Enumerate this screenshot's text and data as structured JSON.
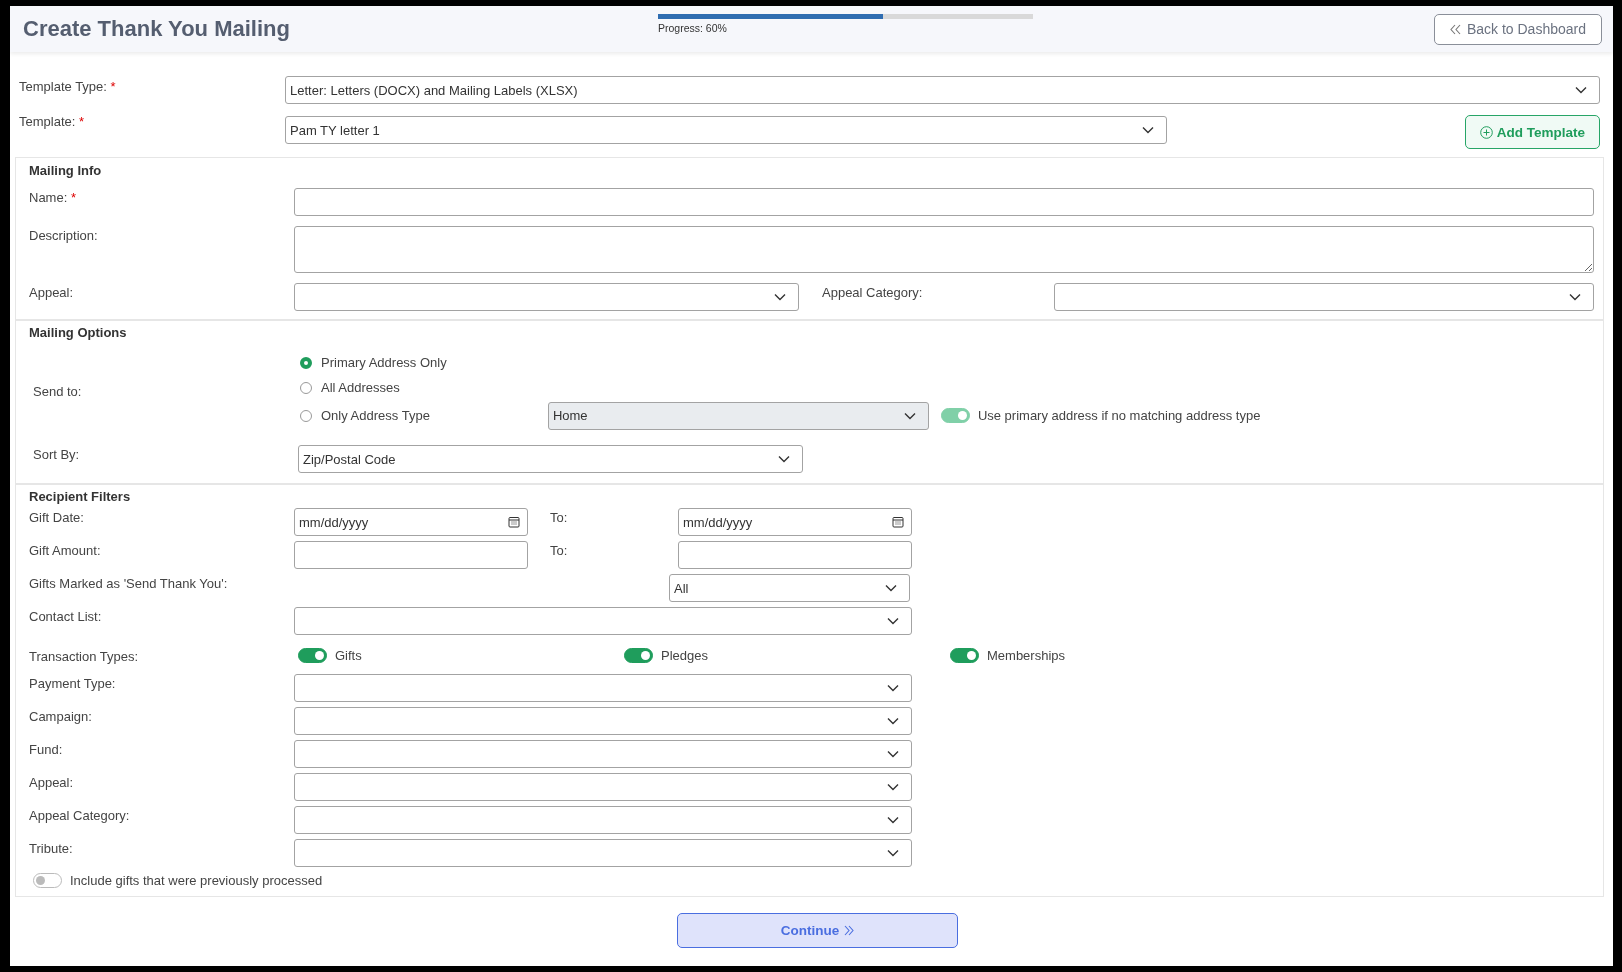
{
  "header": {
    "title": "Create Thank You Mailing",
    "progress": {
      "label": "Progress: 60%",
      "level": 0.6
    },
    "back_button": "Back to Dashboard"
  },
  "template_type": {
    "label": "Template Type:",
    "required_mark": "*",
    "value": "Letter: Letters (DOCX) and Mailing Labels (XLSX)"
  },
  "template": {
    "label": "Template:",
    "required_mark": "*",
    "value": "Pam TY letter 1"
  },
  "add_template_button": "Add Template",
  "mailing_info": {
    "title": "Mailing Info",
    "name": {
      "label": "Name:",
      "required_mark": "*"
    },
    "description": {
      "label": "Description:"
    },
    "appeal": {
      "label": "Appeal:"
    },
    "appeal_category": {
      "label": "Appeal Category:"
    }
  },
  "mailing_options": {
    "title": "Mailing Options",
    "send_to": {
      "label": "Send to:",
      "options": [
        {
          "label": "Primary Address Only",
          "selected": true
        },
        {
          "label": "All Addresses",
          "selected": false
        },
        {
          "label": "Only Address Type",
          "selected": false
        }
      ],
      "address_type": {
        "value": "Home",
        "disabled": true
      },
      "use_primary": {
        "label": "Use primary address if no matching address type",
        "on": true,
        "disabled": true
      }
    },
    "sort_by": {
      "label": "Sort By:",
      "value": "Zip/Postal Code"
    }
  },
  "recipient_filters": {
    "title": "Recipient Filters",
    "gift_date": {
      "label": "Gift Date:",
      "placeholder": "mm/dd/yyyy",
      "to_label": "To:",
      "to_placeholder": "mm/dd/yyyy"
    },
    "gift_amount": {
      "label": "Gift Amount:",
      "to_label": "To:"
    },
    "send_thank_you": {
      "label": "Gifts Marked as 'Send Thank You':",
      "value": "All"
    },
    "contact_list": {
      "label": "Contact List:"
    },
    "transaction_types": {
      "label": "Transaction Types:",
      "items": [
        {
          "label": "Gifts",
          "on": true
        },
        {
          "label": "Pledges",
          "on": true
        },
        {
          "label": "Memberships",
          "on": true
        }
      ]
    },
    "dropdowns": [
      {
        "label": "Payment Type:"
      },
      {
        "label": "Campaign:"
      },
      {
        "label": "Fund:"
      },
      {
        "label": "Appeal:"
      },
      {
        "label": "Appeal Category:"
      },
      {
        "label": "Tribute:"
      }
    ],
    "include_previous": {
      "label": "Include gifts that were previously processed",
      "on": false
    }
  },
  "continue_button": "Continue"
}
